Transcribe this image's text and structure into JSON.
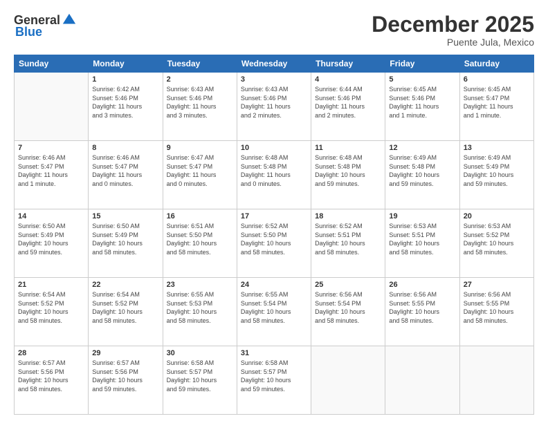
{
  "header": {
    "logo_general": "General",
    "logo_blue": "Blue",
    "month_title": "December 2025",
    "subtitle": "Puente Jula, Mexico"
  },
  "weekdays": [
    "Sunday",
    "Monday",
    "Tuesday",
    "Wednesday",
    "Thursday",
    "Friday",
    "Saturday"
  ],
  "weeks": [
    [
      {
        "day": "",
        "info": ""
      },
      {
        "day": "1",
        "info": "Sunrise: 6:42 AM\nSunset: 5:46 PM\nDaylight: 11 hours\nand 3 minutes."
      },
      {
        "day": "2",
        "info": "Sunrise: 6:43 AM\nSunset: 5:46 PM\nDaylight: 11 hours\nand 3 minutes."
      },
      {
        "day": "3",
        "info": "Sunrise: 6:43 AM\nSunset: 5:46 PM\nDaylight: 11 hours\nand 2 minutes."
      },
      {
        "day": "4",
        "info": "Sunrise: 6:44 AM\nSunset: 5:46 PM\nDaylight: 11 hours\nand 2 minutes."
      },
      {
        "day": "5",
        "info": "Sunrise: 6:45 AM\nSunset: 5:46 PM\nDaylight: 11 hours\nand 1 minute."
      },
      {
        "day": "6",
        "info": "Sunrise: 6:45 AM\nSunset: 5:47 PM\nDaylight: 11 hours\nand 1 minute."
      }
    ],
    [
      {
        "day": "7",
        "info": "Sunrise: 6:46 AM\nSunset: 5:47 PM\nDaylight: 11 hours\nand 1 minute."
      },
      {
        "day": "8",
        "info": "Sunrise: 6:46 AM\nSunset: 5:47 PM\nDaylight: 11 hours\nand 0 minutes."
      },
      {
        "day": "9",
        "info": "Sunrise: 6:47 AM\nSunset: 5:47 PM\nDaylight: 11 hours\nand 0 minutes."
      },
      {
        "day": "10",
        "info": "Sunrise: 6:48 AM\nSunset: 5:48 PM\nDaylight: 11 hours\nand 0 minutes."
      },
      {
        "day": "11",
        "info": "Sunrise: 6:48 AM\nSunset: 5:48 PM\nDaylight: 10 hours\nand 59 minutes."
      },
      {
        "day": "12",
        "info": "Sunrise: 6:49 AM\nSunset: 5:48 PM\nDaylight: 10 hours\nand 59 minutes."
      },
      {
        "day": "13",
        "info": "Sunrise: 6:49 AM\nSunset: 5:49 PM\nDaylight: 10 hours\nand 59 minutes."
      }
    ],
    [
      {
        "day": "14",
        "info": "Sunrise: 6:50 AM\nSunset: 5:49 PM\nDaylight: 10 hours\nand 59 minutes."
      },
      {
        "day": "15",
        "info": "Sunrise: 6:50 AM\nSunset: 5:49 PM\nDaylight: 10 hours\nand 58 minutes."
      },
      {
        "day": "16",
        "info": "Sunrise: 6:51 AM\nSunset: 5:50 PM\nDaylight: 10 hours\nand 58 minutes."
      },
      {
        "day": "17",
        "info": "Sunrise: 6:52 AM\nSunset: 5:50 PM\nDaylight: 10 hours\nand 58 minutes."
      },
      {
        "day": "18",
        "info": "Sunrise: 6:52 AM\nSunset: 5:51 PM\nDaylight: 10 hours\nand 58 minutes."
      },
      {
        "day": "19",
        "info": "Sunrise: 6:53 AM\nSunset: 5:51 PM\nDaylight: 10 hours\nand 58 minutes."
      },
      {
        "day": "20",
        "info": "Sunrise: 6:53 AM\nSunset: 5:52 PM\nDaylight: 10 hours\nand 58 minutes."
      }
    ],
    [
      {
        "day": "21",
        "info": "Sunrise: 6:54 AM\nSunset: 5:52 PM\nDaylight: 10 hours\nand 58 minutes."
      },
      {
        "day": "22",
        "info": "Sunrise: 6:54 AM\nSunset: 5:52 PM\nDaylight: 10 hours\nand 58 minutes."
      },
      {
        "day": "23",
        "info": "Sunrise: 6:55 AM\nSunset: 5:53 PM\nDaylight: 10 hours\nand 58 minutes."
      },
      {
        "day": "24",
        "info": "Sunrise: 6:55 AM\nSunset: 5:54 PM\nDaylight: 10 hours\nand 58 minutes."
      },
      {
        "day": "25",
        "info": "Sunrise: 6:56 AM\nSunset: 5:54 PM\nDaylight: 10 hours\nand 58 minutes."
      },
      {
        "day": "26",
        "info": "Sunrise: 6:56 AM\nSunset: 5:55 PM\nDaylight: 10 hours\nand 58 minutes."
      },
      {
        "day": "27",
        "info": "Sunrise: 6:56 AM\nSunset: 5:55 PM\nDaylight: 10 hours\nand 58 minutes."
      }
    ],
    [
      {
        "day": "28",
        "info": "Sunrise: 6:57 AM\nSunset: 5:56 PM\nDaylight: 10 hours\nand 58 minutes."
      },
      {
        "day": "29",
        "info": "Sunrise: 6:57 AM\nSunset: 5:56 PM\nDaylight: 10 hours\nand 59 minutes."
      },
      {
        "day": "30",
        "info": "Sunrise: 6:58 AM\nSunset: 5:57 PM\nDaylight: 10 hours\nand 59 minutes."
      },
      {
        "day": "31",
        "info": "Sunrise: 6:58 AM\nSunset: 5:57 PM\nDaylight: 10 hours\nand 59 minutes."
      },
      {
        "day": "",
        "info": ""
      },
      {
        "day": "",
        "info": ""
      },
      {
        "day": "",
        "info": ""
      }
    ]
  ]
}
